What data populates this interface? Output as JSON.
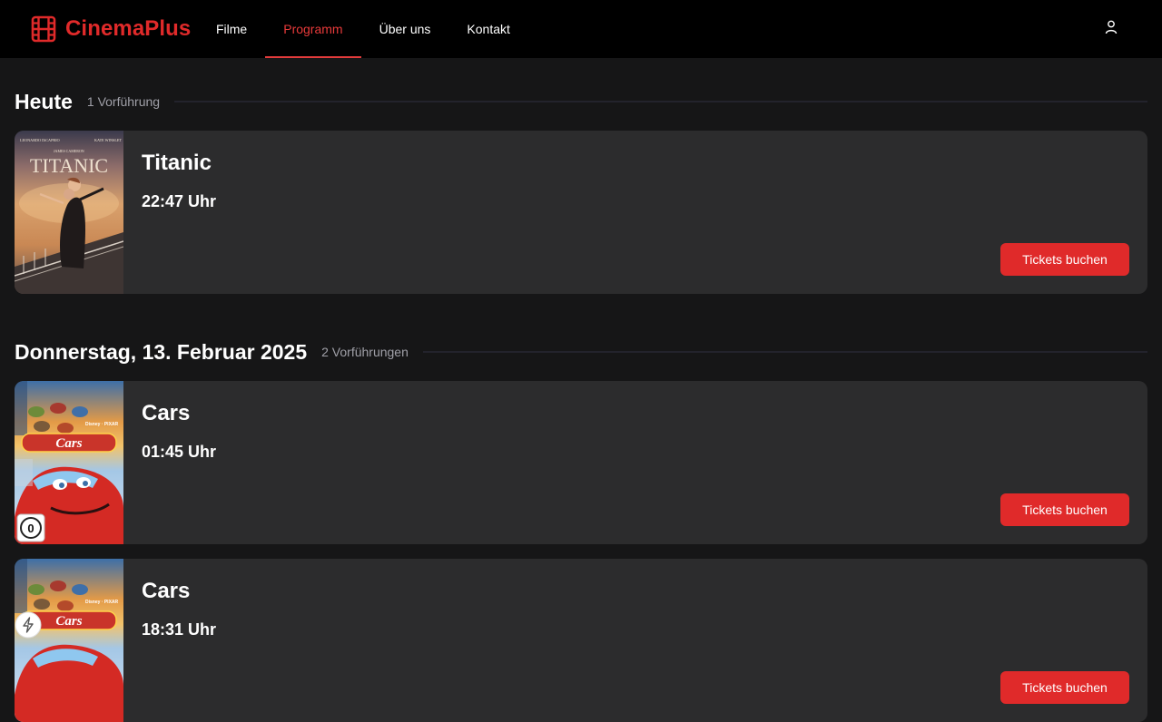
{
  "header": {
    "brand": "CinemaPlus",
    "nav": [
      {
        "label": "Filme"
      },
      {
        "label": "Programm"
      },
      {
        "label": "Über uns"
      },
      {
        "label": "Kontakt"
      }
    ],
    "active_nav": "Programm",
    "icons": {
      "logo": "film-icon",
      "account": "user-icon"
    }
  },
  "colors": {
    "accent": "#e02a2a",
    "page_bg": "#161617",
    "card_bg": "#2c2c2d",
    "header_bg": "#000000"
  },
  "days": [
    {
      "title": "Heute",
      "count": "1 Vorführung",
      "screenings": [
        {
          "movie": "Titanic",
          "time": "22:47 Uhr",
          "button": "Tickets buchen"
        }
      ]
    },
    {
      "title": "Donnerstag, 13. Februar 2025",
      "count": "2 Vorführungen",
      "screenings": [
        {
          "movie": "Cars",
          "time": "01:45 Uhr",
          "button": "Tickets buchen",
          "badge": "0"
        },
        {
          "movie": "Cars",
          "time": "18:31 Uhr",
          "button": "Tickets buchen",
          "badge_icon": "bolt-icon"
        }
      ]
    }
  ],
  "posters": {
    "titanic": {
      "credits_left": "LEONARDO DiCAPRIO",
      "credits_right": "KATE WINSLET",
      "director": "JAMES CAMERON",
      "title": "TITANIC"
    },
    "cars": {
      "title": "Cars"
    }
  }
}
